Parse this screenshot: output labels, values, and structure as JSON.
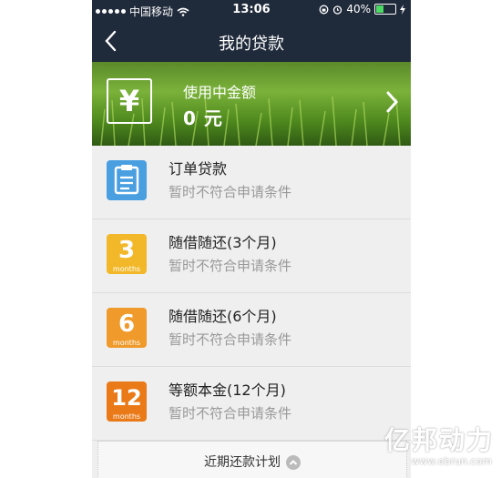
{
  "status_bar": {
    "carrier": "中国移动",
    "time": "13:06",
    "battery": "40%",
    "battery_level": 0.4
  },
  "nav": {
    "title": "我的贷款",
    "back_icon": "chevron-left-icon"
  },
  "banner": {
    "label": "使用中金额",
    "amount": "0 元",
    "icon_symbol": "¥"
  },
  "loans": [
    {
      "title": "订单贷款",
      "status": "暂时不符合申请条件",
      "icon": "clipboard-icon",
      "color": "#4a9fe0"
    },
    {
      "title": "随借随还(3个月)",
      "status": "暂时不符合申请条件",
      "icon_num": "3",
      "icon_unit": "months",
      "color": "#f2b82a"
    },
    {
      "title": "随借随还(6个月)",
      "status": "暂时不符合申请条件",
      "icon_num": "6",
      "icon_unit": "months",
      "color": "#ef9a2a"
    },
    {
      "title": "等额本金(12个月)",
      "status": "暂时不符合申请条件",
      "icon_num": "12",
      "icon_unit": "months",
      "color": "#ea7a18"
    }
  ],
  "footer": {
    "label": "近期还款计划"
  },
  "watermark": {
    "text": "亿邦动力",
    "url": "www.ebrun.com"
  }
}
